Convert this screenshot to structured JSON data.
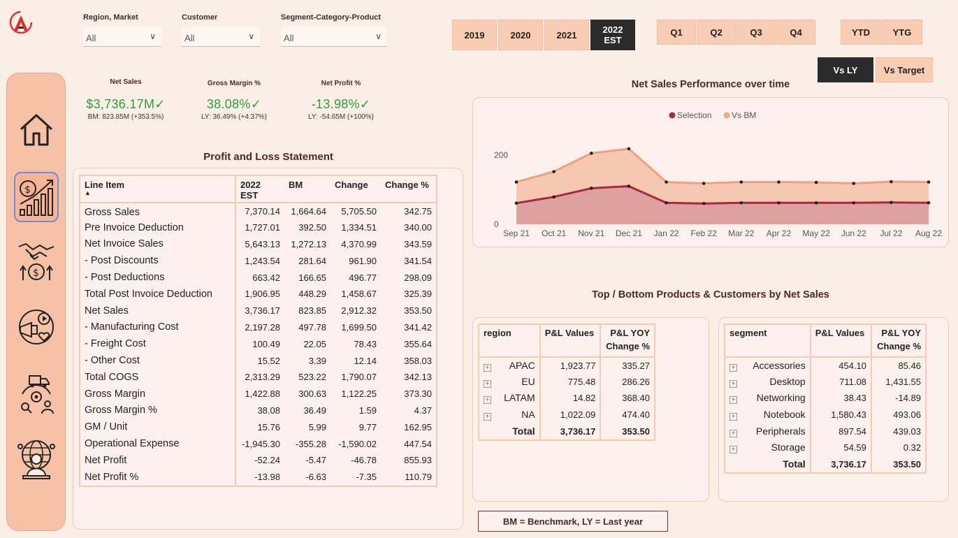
{
  "filters": [
    {
      "label": "Region, Market",
      "value": "All"
    },
    {
      "label": "Customer",
      "value": "All"
    },
    {
      "label": "Segment-Category-Product",
      "value": "All"
    }
  ],
  "years": [
    {
      "label": "2019"
    },
    {
      "label": "2020"
    },
    {
      "label": "2021"
    },
    {
      "label": "2022\nEST",
      "active": true
    }
  ],
  "quarters": [
    {
      "label": "Q1"
    },
    {
      "label": "Q2"
    },
    {
      "label": "Q3"
    },
    {
      "label": "Q4"
    }
  ],
  "periods": [
    {
      "label": "YTD"
    },
    {
      "label": "YTG"
    }
  ],
  "compare": [
    {
      "label": "Vs LY",
      "active": true
    },
    {
      "label": "Vs Target"
    }
  ],
  "kpis": [
    {
      "title": "Net Sales",
      "value": "$3,736.17M✓",
      "sub": "BM: 823.85M (+353.5%)"
    },
    {
      "title": "Gross Margin %",
      "value": "38.08%✓",
      "sub": "LY: 36.49% (+4.37%)"
    },
    {
      "title": "Net Profit %",
      "value": "-13.98%✓",
      "sub": "LY: -54.65M (+100%)"
    }
  ],
  "pl": {
    "title": "Profit and Loss Statement",
    "headers": [
      "Line Item",
      "2022 EST",
      "BM",
      "Change",
      "Change %"
    ],
    "rows": [
      [
        "Gross Sales",
        "7,370.14",
        "1,664.64",
        "5,705.50",
        "342.75"
      ],
      [
        "Pre Invoice Deduction",
        "1,727.01",
        "392.50",
        "1,334.51",
        "340.00"
      ],
      [
        "Net Invoice Sales",
        "5,643.13",
        "1,272.13",
        "4,370.99",
        "343.59"
      ],
      [
        " - Post Discounts",
        "1,243.54",
        "281.64",
        "961.90",
        "341.54"
      ],
      [
        " - Post Deductions",
        "663.42",
        "166.65",
        "496.77",
        "298.09"
      ],
      [
        "Total Post Invoice Deduction",
        "1,906.95",
        "448.29",
        "1,458.67",
        "325.39"
      ],
      [
        "Net Sales",
        "3,736.17",
        "823.85",
        "2,912.32",
        "353.50"
      ],
      [
        " - Manufacturing Cost",
        "2,197.28",
        "497.78",
        "1,699.50",
        "341.42"
      ],
      [
        " - Freight Cost",
        "100.49",
        "22.05",
        "78.43",
        "355.64"
      ],
      [
        " - Other Cost",
        "15.52",
        "3.39",
        "12.14",
        "358.03"
      ],
      [
        "Total COGS",
        "2,313.29",
        "523.22",
        "1,790.07",
        "342.13"
      ],
      [
        "Gross Margin",
        "1,422.88",
        "300.63",
        "1,122.25",
        "373.30"
      ],
      [
        "Gross Margin %",
        "38.08",
        "36.49",
        "1.59",
        "4.37"
      ],
      [
        "GM / Unit",
        "15.76",
        "5.99",
        "9.77",
        "162.95"
      ],
      [
        "Operational Expense",
        "-1,945.30",
        "-355.28",
        "-1,590.02",
        "447.54"
      ],
      [
        "Net Profit",
        "-52.24",
        "-5.47",
        "-46.78",
        "855.93"
      ],
      [
        "Net Profit %",
        "-13.98",
        "-6.63",
        "-7.35",
        "110.79"
      ]
    ]
  },
  "chart_title": "Net Sales Performance over time",
  "chart_data": {
    "type": "area",
    "categories": [
      "Sep 21",
      "Oct 21",
      "Nov 21",
      "Dec 21",
      "Jan 22",
      "Feb 22",
      "Mar 22",
      "Apr 22",
      "May 22",
      "Jun 22",
      "Jul 22",
      "Aug 22"
    ],
    "series": [
      {
        "name": "Selection",
        "color": "#a52a3a",
        "values": [
          61,
          79,
          104,
          110,
          62,
          60,
          62,
          62,
          62,
          62,
          63,
          62
        ]
      },
      {
        "name": "Vs BM",
        "color": "#f0a88a",
        "values": [
          122,
          152,
          205,
          218,
          122,
          118,
          122,
          122,
          121,
          118,
          123,
          122
        ]
      }
    ],
    "yticks": [
      0,
      200
    ],
    "ylim": [
      0,
      240
    ],
    "legend": "top-center"
  },
  "topbottom_title": "Top / Bottom Products & Customers by Net Sales",
  "region_table": {
    "headers": [
      "region",
      "P&L Values",
      "P&L YOY Change %"
    ],
    "rows": [
      [
        "APAC",
        "1,923.77",
        "335.27"
      ],
      [
        "EU",
        "775.48",
        "286.26"
      ],
      [
        "LATAM",
        "14.82",
        "368.40"
      ],
      [
        "NA",
        "1,022.09",
        "474.40"
      ]
    ],
    "total": [
      "Total",
      "3,736.17",
      "353.50"
    ]
  },
  "segment_table": {
    "headers": [
      "segment",
      "P&L Values",
      "P&L YOY Change %"
    ],
    "rows": [
      [
        "Accessories",
        "454.10",
        "85.46"
      ],
      [
        "Desktop",
        "711.08",
        "1,431.55"
      ],
      [
        "Networking",
        "38.43",
        "-14.89"
      ],
      [
        "Notebook",
        "1,580.43",
        "493.06"
      ],
      [
        "Peripherals",
        "897.54",
        "439.03"
      ],
      [
        "Storage",
        "54.59",
        "0.32"
      ]
    ],
    "total": [
      "Total",
      "3,736.17",
      "353.50"
    ]
  },
  "footnote": "BM = Benchmark, LY = Last year",
  "nav": [
    {
      "icon": "home-icon"
    },
    {
      "icon": "finance-growth-icon",
      "active": true
    },
    {
      "icon": "handshake-money-icon"
    },
    {
      "icon": "marketing-icon"
    },
    {
      "icon": "supply-chain-icon"
    },
    {
      "icon": "global-executive-icon"
    }
  ]
}
